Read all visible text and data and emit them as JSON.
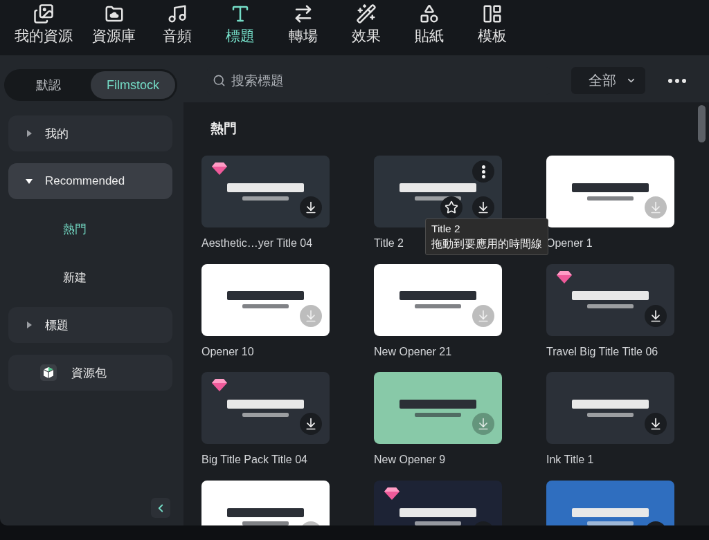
{
  "toolbar": {
    "tabs": [
      {
        "label": "我的資源",
        "selected": false
      },
      {
        "label": "資源庫",
        "selected": false
      },
      {
        "label": "音頻",
        "selected": false
      },
      {
        "label": "標題",
        "selected": true
      },
      {
        "label": "轉場",
        "selected": false
      },
      {
        "label": "效果",
        "selected": false
      },
      {
        "label": "貼紙",
        "selected": false
      },
      {
        "label": "模板",
        "selected": false
      }
    ]
  },
  "source_tabs": [
    {
      "label": "默認",
      "selected": false
    },
    {
      "label": "Filmstock",
      "selected": true
    }
  ],
  "search": {
    "placeholder": "搜索標題"
  },
  "filter": {
    "value": "全部"
  },
  "sidebar": {
    "items": [
      {
        "kind": "group",
        "label": "我的",
        "expanded": false,
        "selected": false
      },
      {
        "kind": "group",
        "label": "Recommended",
        "expanded": true,
        "selected": true,
        "children": [
          {
            "label": "熱門",
            "selected": true
          },
          {
            "label": "新建",
            "selected": false
          }
        ]
      },
      {
        "kind": "group",
        "label": "標題",
        "expanded": false,
        "selected": false
      },
      {
        "kind": "pack",
        "label": "資源包",
        "selected": false
      }
    ]
  },
  "section": {
    "title": "熱門",
    "cards": [
      {
        "label": "Aesthetic…yer Title 04",
        "color": "#2c333b",
        "premium": true,
        "hovered": false
      },
      {
        "label": "Title 2",
        "color": "#2c333b",
        "premium": false,
        "hovered": true
      },
      {
        "label": "Opener 1",
        "color": "#ffffff",
        "premium": false,
        "hovered": false
      },
      {
        "label": "Opener 10",
        "color": "#ffffff",
        "premium": false,
        "hovered": false
      },
      {
        "label": "New Opener 21",
        "color": "#ffffff",
        "premium": false,
        "hovered": false
      },
      {
        "label": "Travel Big Title Title 06",
        "color": "#2b3038",
        "premium": true,
        "hovered": false
      },
      {
        "label": "Big Title Pack Title 04",
        "color": "#2b3038",
        "premium": true,
        "hovered": false
      },
      {
        "label": "New Opener 9",
        "color": "#88c9a8",
        "premium": false,
        "hovered": false
      },
      {
        "label": "Ink Title 1",
        "color": "#2b3038",
        "premium": false,
        "hovered": false
      },
      {
        "color": "#ffffff",
        "premium": false,
        "hovered": false
      },
      {
        "color": "#1d2335",
        "premium": true,
        "hovered": false
      },
      {
        "color": "#2f6ebf",
        "premium": false,
        "hovered": false
      }
    ]
  },
  "tooltip": {
    "title": "Title 2",
    "hint": "拖動到要應用的時間線"
  }
}
